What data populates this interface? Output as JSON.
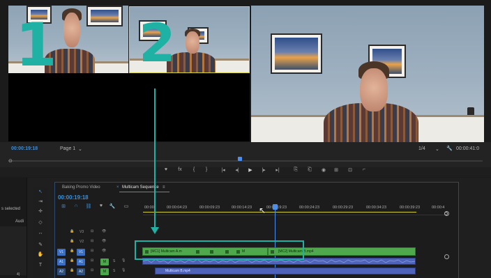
{
  "preview": {
    "cam1_number": "1",
    "cam2_number": "2"
  },
  "program_monitor": {
    "left_timecode": "00:00:19:18",
    "page_selector": "Page 1",
    "zoom": "1/4",
    "right_timecode": "00:00:41:0",
    "controls": [
      "♥",
      "fx",
      "{",
      "}",
      "|◂",
      "◂|",
      "▶",
      "|▸",
      "▸|",
      "⎘",
      "⎗",
      "◉",
      "⊞",
      "⊡",
      "⌐"
    ]
  },
  "timeline": {
    "tabs": [
      "Baking Promo Video",
      "Multicam Sequence"
    ],
    "timecode": "00:00:19:18",
    "ruler": [
      "00:00",
      "00:00:04:23",
      "00:00:09:23",
      "00:00:14:23",
      "00:00:19:23",
      "00:00:24:23",
      "00:00:29:23",
      "00:00:34:23",
      "00:00:39:23",
      "00:00:4"
    ],
    "tracks": {
      "v3": "V3",
      "v2": "V2",
      "v1": "V1",
      "a1": "A1",
      "a2": "A2",
      "src_v1": "V1",
      "src_a1": "A1",
      "src_a2": "A2",
      "m": "M",
      "s": "S"
    },
    "clips": {
      "clip_a": "[MC1] Multicam A.m",
      "clip_b": "[MC2] Multicam B.mp4",
      "fx_tail": "M",
      "audio_clip": "Multicam B.mp4"
    }
  },
  "left_panel": {
    "selected_text": "s selected",
    "audio_label": "Audi",
    "footer_number": "4)"
  },
  "colors": {
    "accent_teal": "#1fb1a4",
    "timecode_blue": "#3e8ed6",
    "clip_green": "#4fa94c",
    "audio_blue": "#4f63b8",
    "playhead_blue": "#4a8ff0"
  }
}
